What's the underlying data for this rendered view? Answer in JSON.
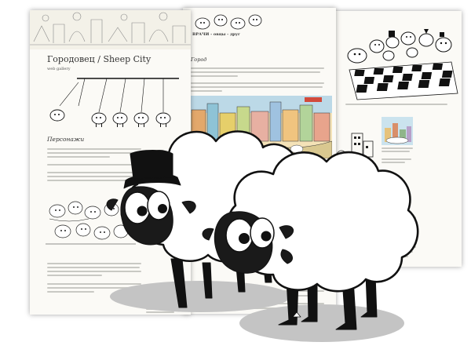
{
  "left_page": {
    "title": "Городовец / Sheep City",
    "subtitle": "web gallery",
    "section_heading": "Персонажи"
  },
  "middle_page": {
    "section_heading": "Город",
    "caption_top": "ВРАЧИ - овцы - друг"
  },
  "colors": {
    "paper": "#fbfaf6",
    "ink": "#111111",
    "text_gray": "#c9c9c4",
    "shadow": "#c4c4c4"
  }
}
